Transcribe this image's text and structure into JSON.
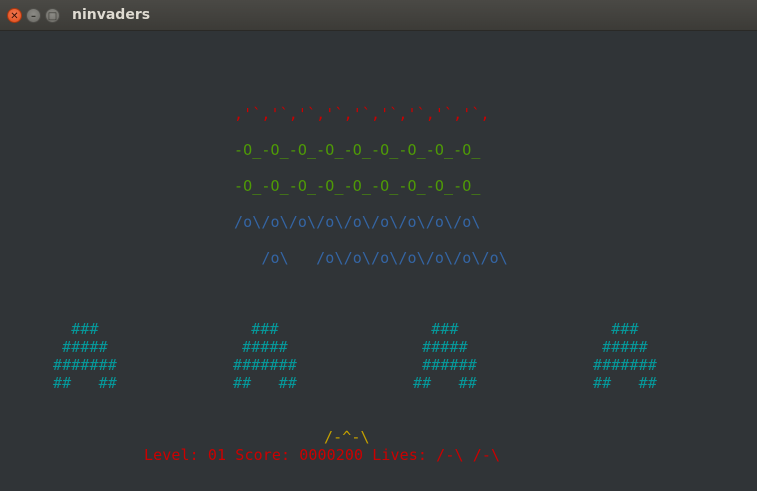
{
  "window": {
    "title": "ninvaders",
    "close_glyph": "✕",
    "minimize_glyph": "–",
    "maximize_glyph": "□"
  },
  "aliens": {
    "row1": ",'`,'`,'`,'`,'`,'`,'`,'`,'`,",
    "row2": "-O_-O_-O_-O_-O_-O_-O_-O_-O_",
    "row3": "-O_-O_-O_-O_-O_-O_-O_-O_-O_",
    "row4": "/o\\/o\\/o\\/o\\/o\\/o\\/o\\/o\\/o\\",
    "row5": "   /o\\   /o\\/o\\/o\\/o\\/o\\/o\\/o\\"
  },
  "bunkers": [
    {
      "lines": [
        "  ###",
        " #####",
        "#######",
        "##   ##"
      ]
    },
    {
      "lines": [
        "  ###",
        " #####",
        "#######",
        "##   ##"
      ]
    },
    {
      "lines": [
        "  ###",
        " #####",
        " ######",
        "##   ##"
      ]
    },
    {
      "lines": [
        "  ###",
        " #####",
        "#######",
        "##   ##"
      ]
    }
  ],
  "player": "/-^-\\",
  "status": "Level: 01 Score: 0000200 Lives: /-\\ /-\\",
  "colors": {
    "red": "#cc0000",
    "green": "#4e9a06",
    "blue": "#3465a4",
    "cyan": "#06989a",
    "yellow": "#c4a000",
    "background": "#303437"
  }
}
